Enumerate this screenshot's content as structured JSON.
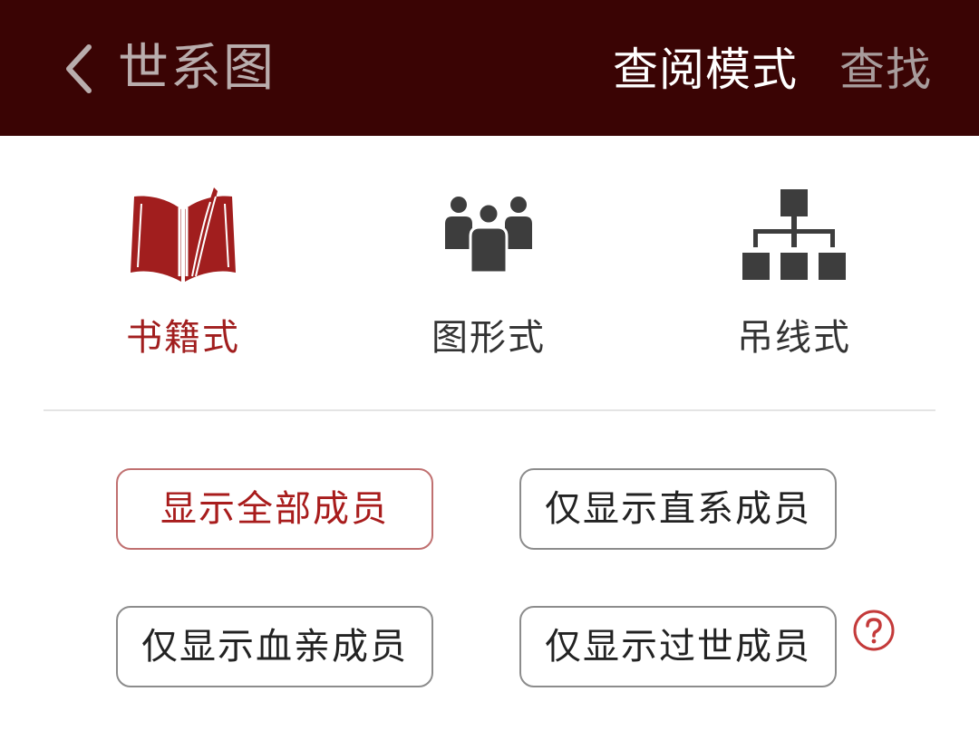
{
  "header": {
    "back_icon": "chevron-left-icon",
    "title": "世系图",
    "mode_title": "查阅模式",
    "find_label": "查找"
  },
  "view_modes": [
    {
      "label": "书籍式",
      "icon": "open-book-icon",
      "active": true
    },
    {
      "label": "图形式",
      "icon": "people-group-icon",
      "active": false
    },
    {
      "label": "吊线式",
      "icon": "org-chart-icon",
      "active": false
    }
  ],
  "filters": [
    {
      "label": "显示全部成员",
      "selected": true
    },
    {
      "label": "仅显示直系成员",
      "selected": false
    },
    {
      "label": "仅显示血亲成员",
      "selected": false
    },
    {
      "label": "仅显示过世成员",
      "selected": false
    }
  ],
  "help_icon": "question-circle-icon",
  "colors": {
    "header_bg": "#3a0404",
    "accent": "#a11e1e",
    "icon_gray": "#3d3d3d"
  }
}
